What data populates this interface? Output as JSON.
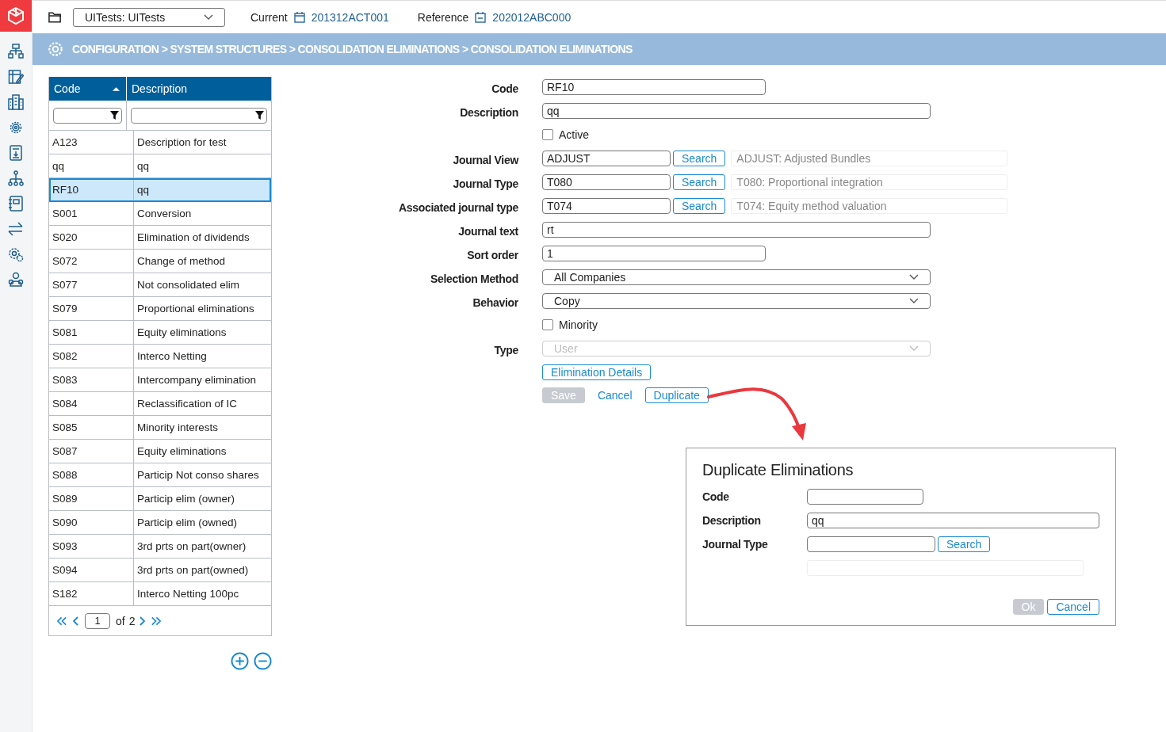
{
  "top_bar": {
    "workspace": "UITests: UITests",
    "current_label": "Current",
    "current_value": "201312ACT001",
    "reference_label": "Reference",
    "reference_value": "202012ABC000"
  },
  "breadcrumb": "CONFIGURATION > SYSTEM STRUCTURES > CONSOLIDATION ELIMINATIONS > CONSOLIDATION ELIMINATIONS",
  "table": {
    "columns": [
      {
        "label": "Code",
        "sorted": true
      },
      {
        "label": "Description",
        "sorted": false
      }
    ],
    "rows": [
      {
        "code": "A123",
        "description": "Description for test",
        "selected": false
      },
      {
        "code": "qq",
        "description": "qq",
        "selected": false
      },
      {
        "code": "RF10",
        "description": "qq",
        "selected": true
      },
      {
        "code": "S001",
        "description": "Conversion",
        "selected": false
      },
      {
        "code": "S020",
        "description": "Elimination of dividends",
        "selected": false
      },
      {
        "code": "S072",
        "description": "Change of method",
        "selected": false
      },
      {
        "code": "S077",
        "description": "Not consolidated elim",
        "selected": false
      },
      {
        "code": "S079",
        "description": "Proportional eliminations",
        "selected": false
      },
      {
        "code": "S081",
        "description": "Equity eliminations",
        "selected": false
      },
      {
        "code": "S082",
        "description": "Interco Netting",
        "selected": false
      },
      {
        "code": "S083",
        "description": "Intercompany elimination",
        "selected": false
      },
      {
        "code": "S084",
        "description": "Reclassification of IC",
        "selected": false
      },
      {
        "code": "S085",
        "description": "Minority interests",
        "selected": false
      },
      {
        "code": "S087",
        "description": "Equity eliminations",
        "selected": false
      },
      {
        "code": "S088",
        "description": "Particip Not conso shares",
        "selected": false
      },
      {
        "code": "S089",
        "description": "Particip elim (owner)",
        "selected": false
      },
      {
        "code": "S090",
        "description": "Particip elim (owned)",
        "selected": false
      },
      {
        "code": "S093",
        "description": "3rd prts on part(owner)",
        "selected": false
      },
      {
        "code": "S094",
        "description": "3rd prts on part(owned)",
        "selected": false
      },
      {
        "code": "S182",
        "description": "Interco Netting 100pc",
        "selected": false
      }
    ],
    "pagination": {
      "page": "1",
      "of": "of",
      "total": "2"
    }
  },
  "form": {
    "fields": [
      {
        "kind": "short_text",
        "label": "Code",
        "value": "RF10"
      },
      {
        "kind": "text",
        "label": "Description",
        "value": "qq"
      },
      {
        "kind": "checkbox",
        "text": "Active",
        "checked": false
      },
      {
        "kind": "lookup",
        "label": "Journal View",
        "value": "ADJUST",
        "button": "Search",
        "description": "ADJUST: Adjusted Bundles"
      },
      {
        "kind": "lookup",
        "label": "Journal Type",
        "value": "T080",
        "button": "Search",
        "description": "T080: Proportional integration"
      },
      {
        "kind": "lookup",
        "label": "Associated journal type",
        "value": "T074",
        "button": "Search",
        "description": "T074: Equity method valuation"
      },
      {
        "kind": "text",
        "label": "Journal text",
        "value": "rt"
      },
      {
        "kind": "short_text",
        "label": "Sort order",
        "value": "1"
      },
      {
        "kind": "select",
        "label": "Selection Method",
        "value": "All Companies",
        "disabled": false
      },
      {
        "kind": "select",
        "label": "Behavior",
        "value": "Copy",
        "disabled": false
      },
      {
        "kind": "checkbox",
        "text": "Minority",
        "checked": false
      },
      {
        "kind": "select",
        "label": "Type",
        "value": "User",
        "disabled": true
      }
    ],
    "details_button": "Elimination Details",
    "buttons": [
      {
        "kind": "button",
        "label": "Save",
        "disabled": true
      },
      {
        "kind": "link",
        "label": "Cancel",
        "disabled": false
      },
      {
        "kind": "button",
        "label": "Duplicate",
        "disabled": false
      }
    ]
  },
  "dialog": {
    "title": "Duplicate Eliminations",
    "fields": [
      {
        "kind": "short_text",
        "label": "Code"
      },
      {
        "kind": "text",
        "label": "Description",
        "value": "qq"
      },
      {
        "kind": "lookup",
        "label": "Journal Type",
        "button": "Search"
      }
    ],
    "buttons": [
      {
        "label": "Ok",
        "disabled": true
      },
      {
        "label": "Cancel",
        "disabled": false
      }
    ]
  }
}
